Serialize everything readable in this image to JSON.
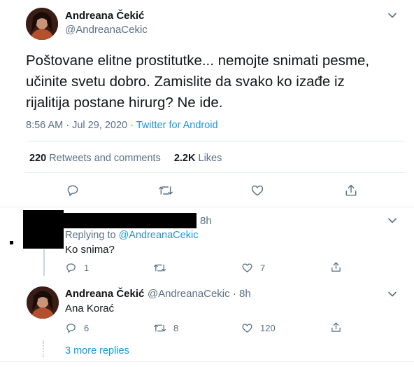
{
  "main_tweet": {
    "author_name": "Andreana Čekić",
    "author_handle": "@AndreanaCekic",
    "text": "Poštovane elitne prostitutke... nemojte snimati pesme, učinite svetu dobro. Zamislite da svako ko izađe iz rijalitija postane hirurg? Ne ide.",
    "time": "8:56 AM · Jul 29, 2020 · ",
    "source": "Twitter for Android",
    "retweets_count": "220",
    "retweets_label": " Retweets and comments",
    "likes_count": "2.2K",
    "likes_label": " Likes"
  },
  "reply1": {
    "time": "8h",
    "replying_prefix": "Replying to ",
    "replying_to": "@AndreanaCekic",
    "text": "Ko snima?",
    "reply_count": "1",
    "retweet_count": "",
    "like_count": "7"
  },
  "reply2": {
    "author_name": "Andreana Čekić",
    "author_handle": "@AndreanaCekic",
    "time": " · 8h",
    "text": "Ana Korać",
    "reply_count": "6",
    "retweet_count": "8",
    "like_count": "120"
  },
  "more_replies": "3 more replies",
  "colors": {
    "link": "#1b95e0",
    "muted": "#5b7083",
    "divider": "#e6ecf0",
    "text": "#14171a"
  },
  "icons": [
    "chevron-down-icon",
    "reply-icon",
    "retweet-icon",
    "like-icon",
    "share-icon"
  ]
}
